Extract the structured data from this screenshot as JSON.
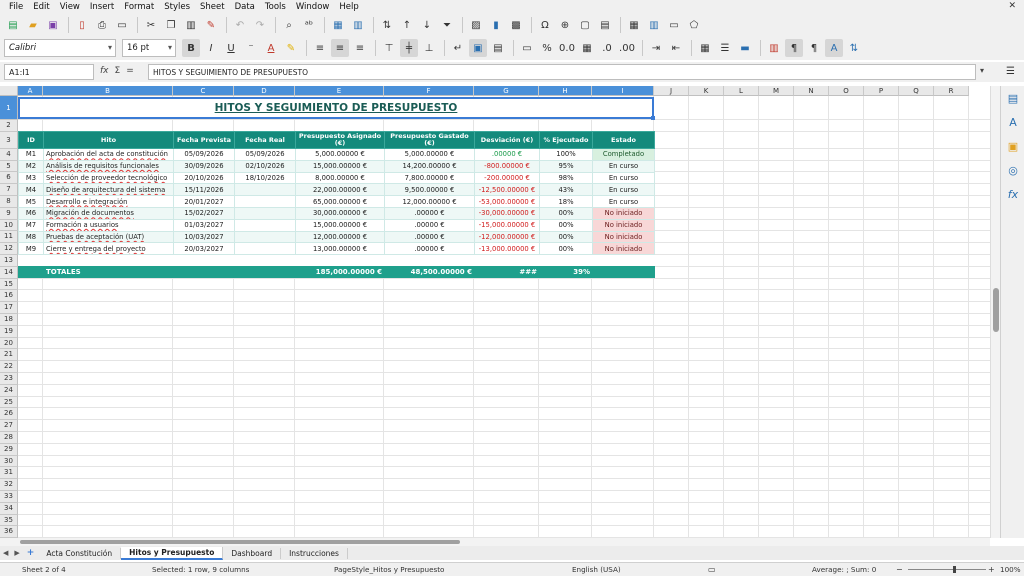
{
  "menu": [
    "File",
    "Edit",
    "View",
    "Insert",
    "Format",
    "Styles",
    "Sheet",
    "Data",
    "Tools",
    "Window",
    "Help"
  ],
  "font": {
    "name": "Calibri",
    "size": "16 pt"
  },
  "formula_bar": {
    "cell_ref": "A1:I1",
    "content": "HITOS Y SEGUIMIENTO DE PRESUPUESTO"
  },
  "columns": [
    "A",
    "B",
    "C",
    "D",
    "E",
    "F",
    "G",
    "H",
    "I",
    "J",
    "K",
    "L",
    "M",
    "N",
    "O",
    "P",
    "Q",
    "R"
  ],
  "rows": [
    "1",
    "2",
    "3",
    "4",
    "5",
    "6",
    "7",
    "8",
    "9",
    "10",
    "11",
    "12",
    "13",
    "14",
    "15",
    "16",
    "17",
    "18",
    "19",
    "20",
    "21",
    "22",
    "23",
    "24",
    "25",
    "26",
    "27",
    "28",
    "29",
    "30",
    "31",
    "32",
    "33",
    "34",
    "35",
    "36"
  ],
  "sheet": {
    "title": "HITOS Y SEGUIMIENTO DE PRESUPUESTO",
    "headers": [
      "ID",
      "Hito",
      "Fecha Prevista",
      "Fecha Real",
      "Presupuesto Asignado (€)",
      "Presupuesto Gastado (€)",
      "Desviación (€)",
      "% Ejecutado",
      "Estado"
    ],
    "rows": [
      {
        "id": "M1",
        "hito": "Aprobación del acta de constitución",
        "prevista": "05/09/2026",
        "real": "05/09/2026",
        "asignado": "5,000.00000 €",
        "gastado": "5,000.00000 €",
        "desviacion": ".00000 €",
        "pct": "100%",
        "estado": "Completado"
      },
      {
        "id": "M2",
        "hito": "Análisis de requisitos funcionales",
        "prevista": "30/09/2026",
        "real": "02/10/2026",
        "asignado": "15,000.00000 €",
        "gastado": "14,200.00000 €",
        "desviacion": "-800.00000 €",
        "pct": "95%",
        "estado": "En curso"
      },
      {
        "id": "M3",
        "hito": "Selección de proveedor tecnológico",
        "prevista": "20/10/2026",
        "real": "18/10/2026",
        "asignado": "8,000.00000 €",
        "gastado": "7,800.00000 €",
        "desviacion": "-200.00000 €",
        "pct": "98%",
        "estado": "En curso"
      },
      {
        "id": "M4",
        "hito": "Diseño de arquitectura del sistema",
        "prevista": "15/11/2026",
        "real": "",
        "asignado": "22,000.00000 €",
        "gastado": "9,500.00000 €",
        "desviacion": "-12,500.00000 €",
        "pct": "43%",
        "estado": "En curso"
      },
      {
        "id": "M5",
        "hito": "Desarrollo e integración",
        "prevista": "20/01/2027",
        "real": "",
        "asignado": "65,000.00000 €",
        "gastado": "12,000.00000 €",
        "desviacion": "-53,000.00000 €",
        "pct": "18%",
        "estado": "En curso"
      },
      {
        "id": "M6",
        "hito": "Migración de documentos",
        "prevista": "15/02/2027",
        "real": "",
        "asignado": "30,000.00000 €",
        "gastado": ".00000 €",
        "desviacion": "-30,000.00000 €",
        "pct": "00%",
        "estado": "No iniciado"
      },
      {
        "id": "M7",
        "hito": "Formación a usuarios",
        "prevista": "01/03/2027",
        "real": "",
        "asignado": "15,000.00000 €",
        "gastado": ".00000 €",
        "desviacion": "-15,000.00000 €",
        "pct": "00%",
        "estado": "No iniciado"
      },
      {
        "id": "M8",
        "hito": "Pruebas de aceptación (UAT)",
        "prevista": "10/03/2027",
        "real": "",
        "asignado": "12,000.00000 €",
        "gastado": ".00000 €",
        "desviacion": "-12,000.00000 €",
        "pct": "00%",
        "estado": "No iniciado"
      },
      {
        "id": "M9",
        "hito": "Cierre y entrega del proyecto",
        "prevista": "20/03/2027",
        "real": "",
        "asignado": "13,000.00000 €",
        "gastado": ".00000 €",
        "desviacion": "-13,000.00000 €",
        "pct": "00%",
        "estado": "No iniciado"
      }
    ],
    "totals": {
      "label": "TOTALES",
      "asignado": "185,000.00000 €",
      "gastado": "48,500.00000 €",
      "desviacion": "###",
      "pct": "39%"
    }
  },
  "tabs": [
    "Acta Constitución",
    "Hitos y Presupuesto",
    "Dashboard",
    "Instrucciones"
  ],
  "active_tab": "Hitos y Presupuesto",
  "status": {
    "sheet": "Sheet 2 of 4",
    "selection": "Selected: 1 row, 9 columns",
    "page_style": "PageStyle_Hitos y Presupuesto",
    "language": "English (USA)",
    "summary": "Average: ; Sum: 0",
    "zoom": "100%"
  },
  "colors": {
    "header_teal": "#148a7c",
    "total_teal": "#1fa08c",
    "selection_blue": "#4a90d9",
    "negative": "#d12020"
  }
}
